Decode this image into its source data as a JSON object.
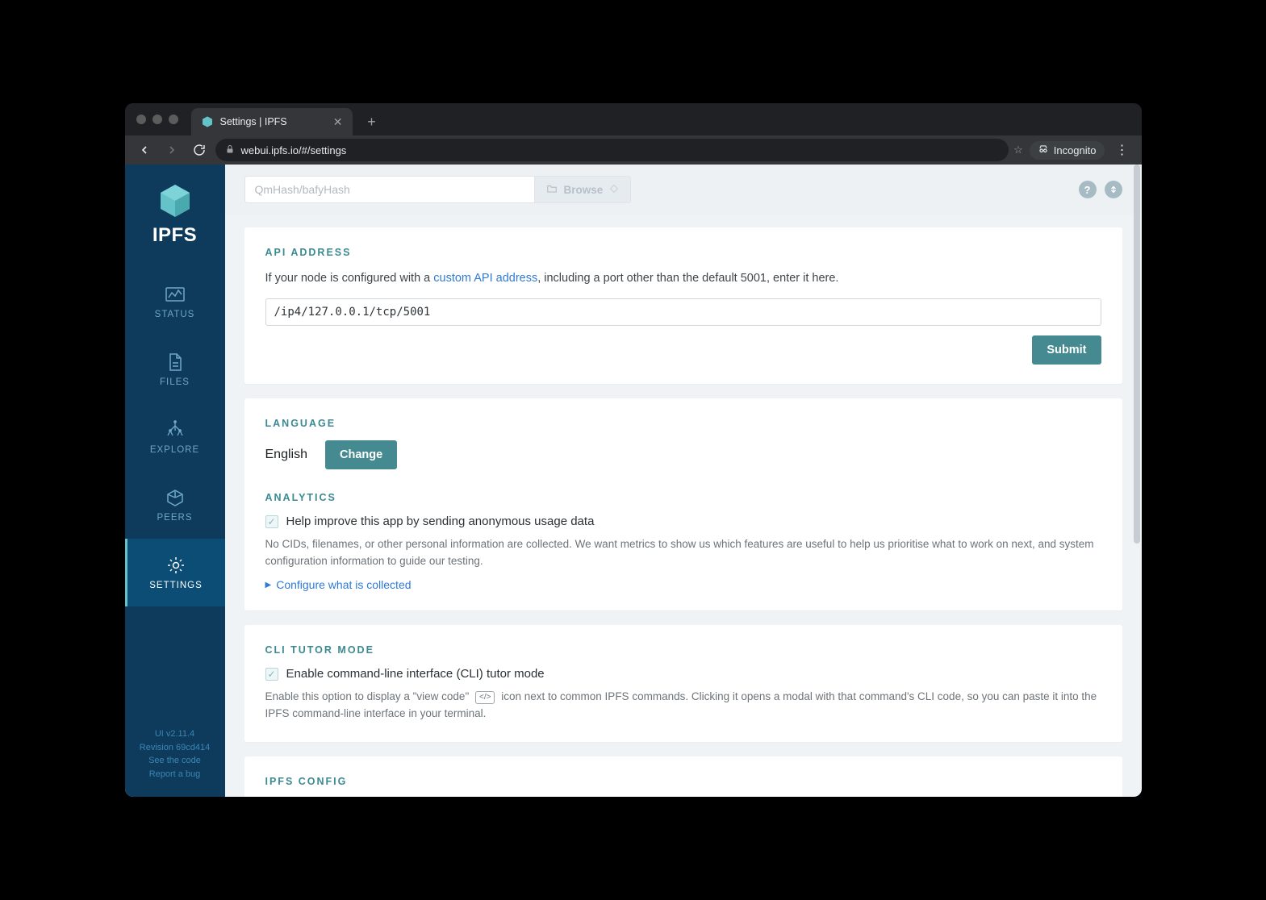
{
  "browser": {
    "tab_title": "Settings | IPFS",
    "url": "webui.ipfs.io/#/settings",
    "incognito_label": "Incognito"
  },
  "sidebar": {
    "logo_text": "IPFS",
    "items": [
      {
        "label": "STATUS",
        "id": "status"
      },
      {
        "label": "FILES",
        "id": "files"
      },
      {
        "label": "EXPLORE",
        "id": "explore"
      },
      {
        "label": "PEERS",
        "id": "peers"
      },
      {
        "label": "SETTINGS",
        "id": "settings"
      }
    ]
  },
  "footer": {
    "version": "UI v2.11.4",
    "revision": "Revision 69cd414",
    "see_code": "See the code",
    "report_bug": "Report a bug"
  },
  "topbar": {
    "search_placeholder": "QmHash/bafyHash",
    "browse_label": "Browse"
  },
  "api": {
    "title": "API ADDRESS",
    "desc_before": "If your node is configured with a ",
    "desc_link": "custom API address",
    "desc_after": ", including a port other than the default 5001, enter it here.",
    "value": "/ip4/127.0.0.1/tcp/5001",
    "submit": "Submit"
  },
  "language": {
    "title": "LANGUAGE",
    "current": "English",
    "change": "Change"
  },
  "analytics": {
    "title": "ANALYTICS",
    "checkbox_label": "Help improve this app by sending anonymous usage data",
    "description": "No CIDs, filenames, or other personal information are collected. We want metrics to show us which features are useful to help us prioritise what to work on next, and system configuration information to guide our testing.",
    "configure_link": "Configure what is collected"
  },
  "cli": {
    "title": "CLI TUTOR MODE",
    "checkbox_label": "Enable command-line interface (CLI) tutor mode",
    "desc_before": "Enable this option to display a \"view code\"",
    "desc_after": "icon next to common IPFS commands. Clicking it opens a modal with that command's CLI code, so you can paste it into the IPFS command-line interface in your terminal."
  },
  "config": {
    "title": "IPFS CONFIG"
  }
}
